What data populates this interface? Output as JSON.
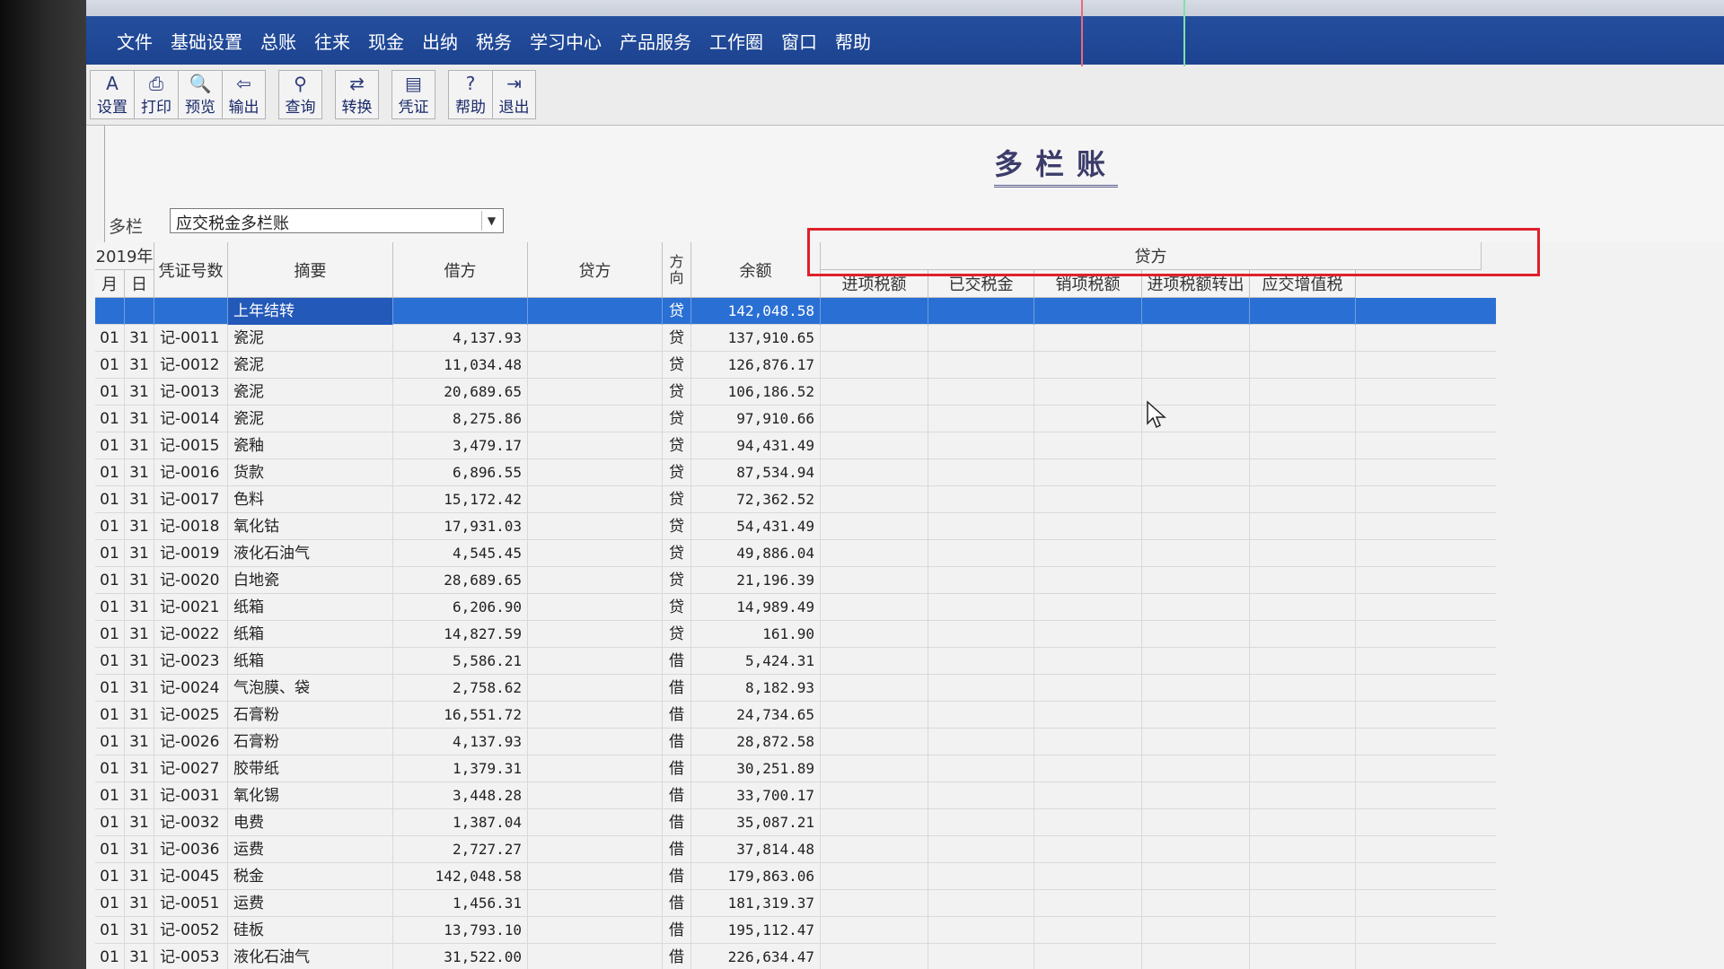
{
  "menu": [
    "文件",
    "基础设置",
    "总账",
    "往来",
    "现金",
    "出纳",
    "税务",
    "学习中心",
    "产品服务",
    "工作圈",
    "窗口",
    "帮助"
  ],
  "toolbar": {
    "groups": [
      [
        {
          "icon": "settings-icon",
          "glyph": "A",
          "label": "设置"
        },
        {
          "icon": "print-icon",
          "glyph": "⎙",
          "label": "打印"
        },
        {
          "icon": "preview-icon",
          "glyph": "🔍",
          "label": "预览"
        },
        {
          "icon": "export-icon",
          "glyph": "⇦",
          "label": "输出"
        }
      ],
      [
        {
          "icon": "query-icon",
          "glyph": "⚲",
          "label": "查询"
        }
      ],
      [
        {
          "icon": "convert-icon",
          "glyph": "⇄",
          "label": "转换"
        }
      ],
      [
        {
          "icon": "voucher-icon",
          "glyph": "▤",
          "label": "凭证"
        }
      ],
      [
        {
          "icon": "help-icon",
          "glyph": "?",
          "label": "帮助"
        },
        {
          "icon": "exit-icon",
          "glyph": "⇥",
          "label": "退出"
        }
      ]
    ]
  },
  "report": {
    "title": "多栏账",
    "filter_label": "多栏",
    "filter_value": "应交税金多栏账"
  },
  "table": {
    "year_header": "2019年",
    "month_header": "月",
    "day_header": "日",
    "voucher_header": "凭证号数",
    "summary_header": "摘要",
    "debit_header": "借方",
    "credit_header": "贷方",
    "direction_header": "方向",
    "balance_header": "余额",
    "credit_group_header": "贷方",
    "sub_headers": [
      "进项税额",
      "已交税金",
      "销项税额",
      "进项税额转出",
      "应交增值税"
    ],
    "opening_row": {
      "summary": "上年结转",
      "direction": "贷",
      "balance": "142,048.58"
    },
    "rows": [
      {
        "m": "01",
        "d": "31",
        "v": "记-0011",
        "s": "瓷泥",
        "debit": "4,137.93",
        "dir": "贷",
        "bal": "137,910.65"
      },
      {
        "m": "01",
        "d": "31",
        "v": "记-0012",
        "s": "瓷泥",
        "debit": "11,034.48",
        "dir": "贷",
        "bal": "126,876.17"
      },
      {
        "m": "01",
        "d": "31",
        "v": "记-0013",
        "s": "瓷泥",
        "debit": "20,689.65",
        "dir": "贷",
        "bal": "106,186.52"
      },
      {
        "m": "01",
        "d": "31",
        "v": "记-0014",
        "s": "瓷泥",
        "debit": "8,275.86",
        "dir": "贷",
        "bal": "97,910.66"
      },
      {
        "m": "01",
        "d": "31",
        "v": "记-0015",
        "s": "瓷釉",
        "debit": "3,479.17",
        "dir": "贷",
        "bal": "94,431.49"
      },
      {
        "m": "01",
        "d": "31",
        "v": "记-0016",
        "s": "货款",
        "debit": "6,896.55",
        "dir": "贷",
        "bal": "87,534.94"
      },
      {
        "m": "01",
        "d": "31",
        "v": "记-0017",
        "s": "色料",
        "debit": "15,172.42",
        "dir": "贷",
        "bal": "72,362.52"
      },
      {
        "m": "01",
        "d": "31",
        "v": "记-0018",
        "s": "氧化钴",
        "debit": "17,931.03",
        "dir": "贷",
        "bal": "54,431.49"
      },
      {
        "m": "01",
        "d": "31",
        "v": "记-0019",
        "s": "液化石油气",
        "debit": "4,545.45",
        "dir": "贷",
        "bal": "49,886.04"
      },
      {
        "m": "01",
        "d": "31",
        "v": "记-0020",
        "s": "白地瓷",
        "debit": "28,689.65",
        "dir": "贷",
        "bal": "21,196.39"
      },
      {
        "m": "01",
        "d": "31",
        "v": "记-0021",
        "s": "纸箱",
        "debit": "6,206.90",
        "dir": "贷",
        "bal": "14,989.49"
      },
      {
        "m": "01",
        "d": "31",
        "v": "记-0022",
        "s": "纸箱",
        "debit": "14,827.59",
        "dir": "贷",
        "bal": "161.90"
      },
      {
        "m": "01",
        "d": "31",
        "v": "记-0023",
        "s": "纸箱",
        "debit": "5,586.21",
        "dir": "借",
        "bal": "5,424.31"
      },
      {
        "m": "01",
        "d": "31",
        "v": "记-0024",
        "s": "气泡膜、袋",
        "debit": "2,758.62",
        "dir": "借",
        "bal": "8,182.93"
      },
      {
        "m": "01",
        "d": "31",
        "v": "记-0025",
        "s": "石膏粉",
        "debit": "16,551.72",
        "dir": "借",
        "bal": "24,734.65"
      },
      {
        "m": "01",
        "d": "31",
        "v": "记-0026",
        "s": "石膏粉",
        "debit": "4,137.93",
        "dir": "借",
        "bal": "28,872.58"
      },
      {
        "m": "01",
        "d": "31",
        "v": "记-0027",
        "s": "胶带纸",
        "debit": "1,379.31",
        "dir": "借",
        "bal": "30,251.89"
      },
      {
        "m": "01",
        "d": "31",
        "v": "记-0031",
        "s": "氧化锡",
        "debit": "3,448.28",
        "dir": "借",
        "bal": "33,700.17"
      },
      {
        "m": "01",
        "d": "31",
        "v": "记-0032",
        "s": "电费",
        "debit": "1,387.04",
        "dir": "借",
        "bal": "35,087.21"
      },
      {
        "m": "01",
        "d": "31",
        "v": "记-0036",
        "s": "运费",
        "debit": "2,727.27",
        "dir": "借",
        "bal": "37,814.48"
      },
      {
        "m": "01",
        "d": "31",
        "v": "记-0045",
        "s": "税金",
        "debit": "142,048.58",
        "dir": "借",
        "bal": "179,863.06"
      },
      {
        "m": "01",
        "d": "31",
        "v": "记-0051",
        "s": "运费",
        "debit": "1,456.31",
        "dir": "借",
        "bal": "181,319.37"
      },
      {
        "m": "01",
        "d": "31",
        "v": "记-0052",
        "s": "硅板",
        "debit": "13,793.10",
        "dir": "借",
        "bal": "195,112.47"
      },
      {
        "m": "01",
        "d": "31",
        "v": "记-0053",
        "s": "液化石油气",
        "debit": "31,522.00",
        "dir": "借",
        "bal": "226,634.47"
      }
    ]
  },
  "colors": {
    "menubar": "#1d4390",
    "selection": "#2a6fd3",
    "highlight_box": "#e0202a"
  }
}
